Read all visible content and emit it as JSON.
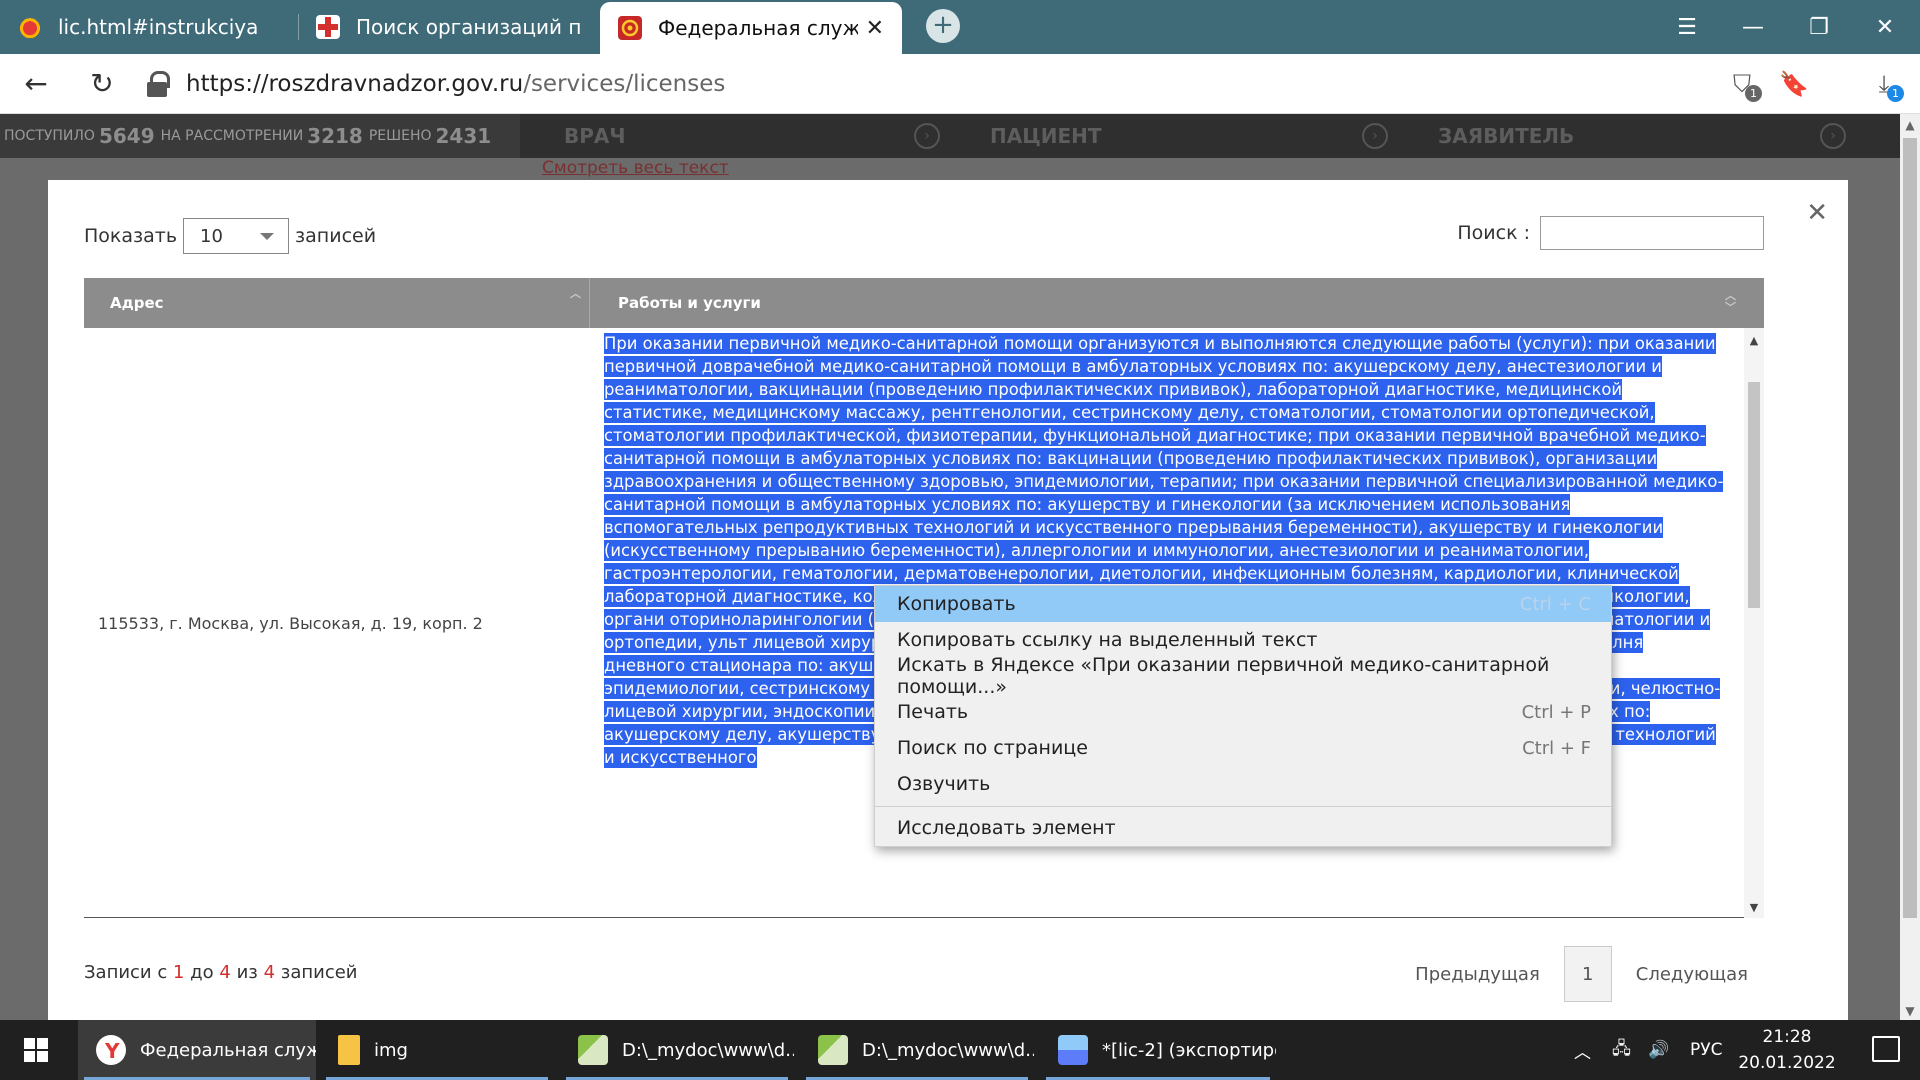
{
  "browser": {
    "tabs": [
      {
        "title": "lic.html#instrukciya"
      },
      {
        "title": "Поиск организаций по ре"
      },
      {
        "title": "Федеральная служба п"
      }
    ],
    "url_host": "https://roszdravnadzor.gov.ru",
    "url_path": "/services/licenses",
    "download_badge": "1",
    "shield_badge": "1"
  },
  "page": {
    "counters": {
      "received_label": "ПОСТУПИЛО",
      "received": "5649",
      "pending_label": "НА РАССМОТРЕНИИ",
      "pending": "3218",
      "solved_label": "РЕШЕНО",
      "solved": "2431"
    },
    "roles": [
      "ВРАЧ",
      "ПАЦИЕНТ",
      "ЗАЯВИТЕЛЬ"
    ],
    "see_all": "Смотреть весь текст"
  },
  "modal": {
    "show_label": "Показать",
    "page_size": "10",
    "records_label": "записей",
    "search_label": "Поиск :",
    "search_value": "",
    "columns": [
      "Адрес",
      "Работы и услуги"
    ],
    "row": {
      "address": "115533, г. Москва, ул. Высокая, д. 19, корп. 2",
      "works": "При оказании первичной медико-санитарной помощи организуются и выполняются следующие работы (услуги): при оказании первичной доврачебной медико-санитарной помощи в амбулаторных условиях по: акушерскому делу, анестезиологии и реаниматологии, вакцинации (проведению профилактических прививок), лабораторной диагностике, медицинской статистике, медицинскому массажу, рентгенологии, сестринскому делу, стоматологии, стоматологии ортопедической, стоматологии профилактической, физиотерапии, функциональной диагностике; при оказании первичной врачебной медико-санитарной помощи в амбулаторных условиях по: вакцинации (проведению профилактических прививок), организации здравоохранения и общественному здоровью, эпидемиологии, терапии; при оказании первичной специализированной медико-санитарной помощи в амбулаторных условиях по: акушерству и гинекологии (за исключением использования вспомогательных репродуктивных технологий и искусственного прерывания беременности), акушерству и гинекологии (искусственному прерыванию беременности), аллергологии и иммунологии, анестезиологии и реаниматологии, гастроэнтерологии, гематологии, дерматовенерологии, диетологии, инфекционным болезням, кардиологии, клинической лабораторной диагностике, колопроктологии, косметологии, мануальной терапии, неврологии, нейрохирургии, онкологии, органи оториноларингологии (за исключ наркологии, пульмонологии, рев стоматологии общей практики, ст травматологии и ортопедии, ульт лицевой хирургии, эндокринолог условиях дневного стационара по помощи организуются и выполня дневного стационара по: акушер репродуктивных технологий и ис беременности), анестезиологии и здоровью, эпидемиологии, сестринскому делу, травматологии и ортопедии, ультразвуковой диагностике, урологии, хирургии, челюстно-лицевой хирургии, эндоскопии; при оказании специализированной медицинской помощи в стационарных условиях по: акушерскому делу, акушерству и гинекологии (за исключением использования вспомогательных репродуктивных технологий и искусственного"
    },
    "info_prefix": "Записи с",
    "info_from": "1",
    "info_to_label": "до",
    "info_to": "4",
    "info_of_label": "из",
    "info_total": "4",
    "info_suffix": "записей",
    "pager": {
      "prev": "Предыдущая",
      "page": "1",
      "next": "Следующая"
    }
  },
  "context_menu": {
    "items": [
      {
        "label": "Копировать",
        "shortcut": "Ctrl + C"
      },
      {
        "label": "Копировать ссылку на выделенный текст",
        "shortcut": ""
      },
      {
        "label": "Искать в Яндексе «При оказании первичной медико-санитарной помощи...»",
        "shortcut": ""
      },
      {
        "label": "Печать",
        "shortcut": "Ctrl + P"
      },
      {
        "label": "Поиск по странице",
        "shortcut": "Ctrl + F"
      },
      {
        "label": "Озвучить",
        "shortcut": ""
      },
      {
        "label": "Исследовать элемент",
        "shortcut": ""
      }
    ]
  },
  "taskbar": {
    "apps": [
      {
        "label": "Федеральная служ..."
      },
      {
        "label": "img"
      },
      {
        "label": "D:\\_mydoc\\www\\d..."
      },
      {
        "label": "D:\\_mydoc\\www\\d..."
      },
      {
        "label": "*[lic-2] (экспортиро..."
      }
    ],
    "lang": "РУС",
    "time": "21:28",
    "date": "20.01.2022"
  },
  "colors": {
    "tabbar": "#3f6b78",
    "selection": "#2c62ed",
    "menu_highlight": "#91c9f7",
    "info_red": "#d32f2f"
  }
}
